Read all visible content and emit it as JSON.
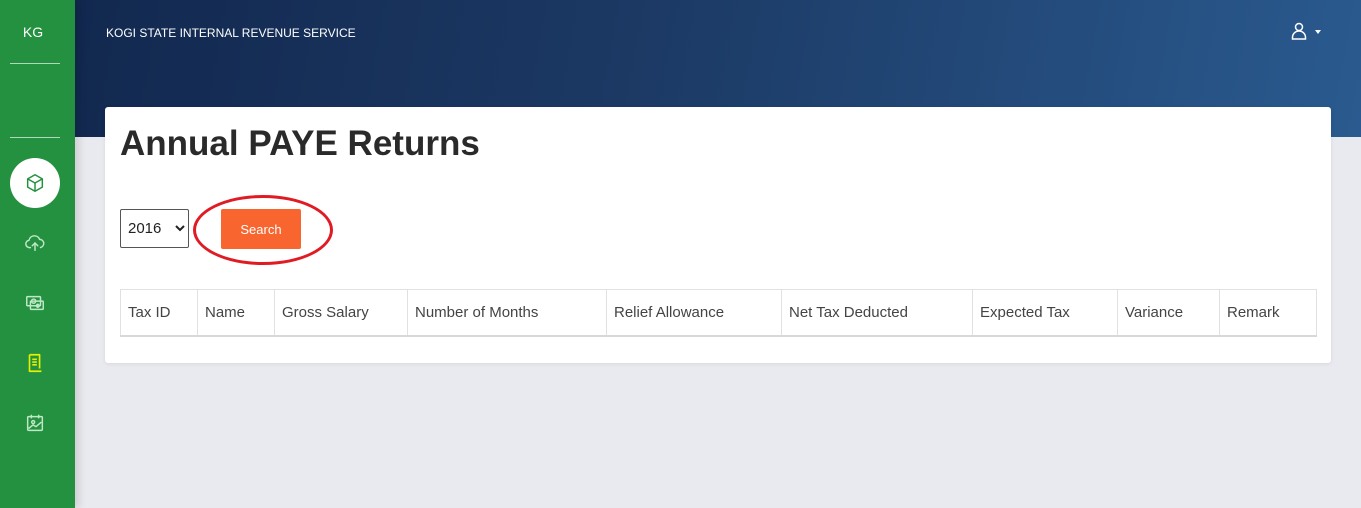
{
  "sidebar": {
    "brand": "KG",
    "items": [
      {
        "icon": "box-icon",
        "active": true
      },
      {
        "icon": "cloud-upload-icon",
        "active": false
      },
      {
        "icon": "money-icon",
        "active": false
      },
      {
        "icon": "receipt-icon",
        "active": false
      },
      {
        "icon": "calendar-image-icon",
        "active": false
      }
    ]
  },
  "header": {
    "title": "KOGI STATE INTERNAL REVENUE SERVICE",
    "user_icon": "user-icon"
  },
  "main": {
    "title": "Annual PAYE Returns",
    "year_select": {
      "selected": "2016",
      "options": [
        "2016"
      ]
    },
    "search_label": "Search",
    "table": {
      "columns": [
        "Tax ID",
        "Name",
        "Gross Salary",
        "Number of Months",
        "Relief Allowance",
        "Net Tax Deducted",
        "Expected Tax",
        "Variance",
        "Remark"
      ],
      "rows": []
    }
  },
  "colors": {
    "sidebar": "#23913f",
    "header_start": "#12284f",
    "header_end": "#2a5a8f",
    "accent": "#f8652e",
    "annotation": "#e01b24",
    "active_icon": "#e4f000"
  }
}
